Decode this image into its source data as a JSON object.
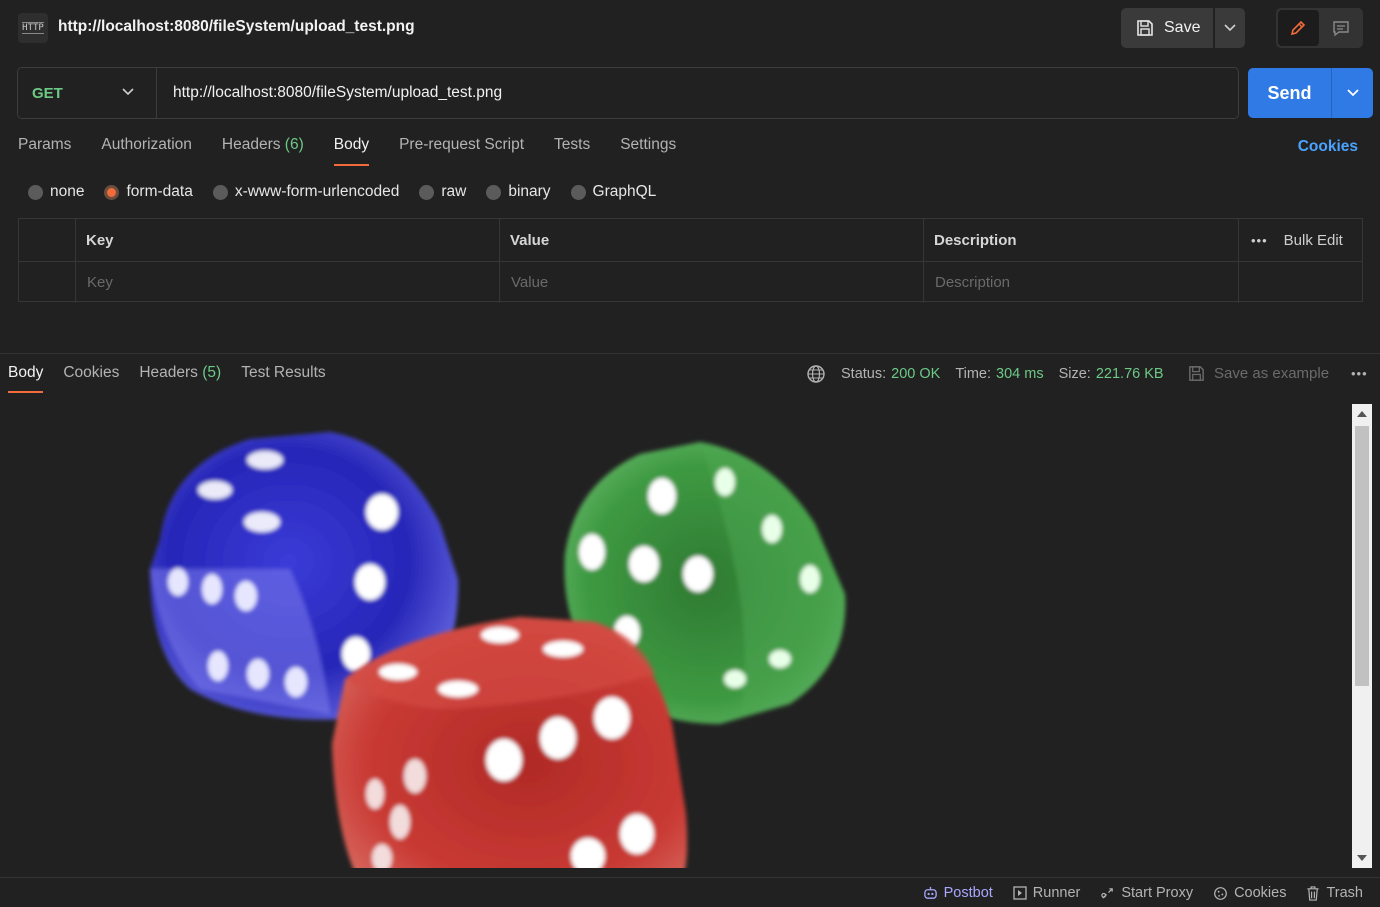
{
  "header": {
    "icon_label": "HTTP",
    "title": "http://localhost:8080/fileSystem/upload_test.png",
    "save_label": "Save"
  },
  "request": {
    "method": "GET",
    "url": "http://localhost:8080/fileSystem/upload_test.png",
    "send_label": "Send"
  },
  "request_tabs": {
    "params": "Params",
    "authorization": "Authorization",
    "headers": "Headers",
    "headers_count": "(6)",
    "body": "Body",
    "prerequest": "Pre-request Script",
    "tests": "Tests",
    "settings": "Settings",
    "cookies": "Cookies"
  },
  "body_types": {
    "none": "none",
    "form_data": "form-data",
    "urlencoded": "x-www-form-urlencoded",
    "raw": "raw",
    "binary": "binary",
    "graphql": "GraphQL",
    "selected": "form-data"
  },
  "params_table": {
    "headers": {
      "key": "Key",
      "value": "Value",
      "description": "Description",
      "more": "•••",
      "bulk_edit": "Bulk Edit"
    },
    "placeholders": {
      "key": "Key",
      "value": "Value",
      "description": "Description"
    }
  },
  "response": {
    "tabs": {
      "body": "Body",
      "cookies": "Cookies",
      "headers": "Headers",
      "headers_count": "(5)",
      "test_results": "Test Results"
    },
    "status_label": "Status:",
    "status_value": "200 OK",
    "time_label": "Time:",
    "time_value": "304 ms",
    "size_label": "Size:",
    "size_value": "221.76 KB",
    "save_example": "Save as example",
    "more": "•••"
  },
  "footer": {
    "postbot": "Postbot",
    "runner": "Runner",
    "start_proxy": "Start Proxy",
    "cookies": "Cookies",
    "trash": "Trash"
  },
  "colors": {
    "accent_orange": "#f26b3a",
    "send_blue": "#2f7ae5",
    "success_green": "#6cc986",
    "link_blue": "#4aa3ff"
  }
}
